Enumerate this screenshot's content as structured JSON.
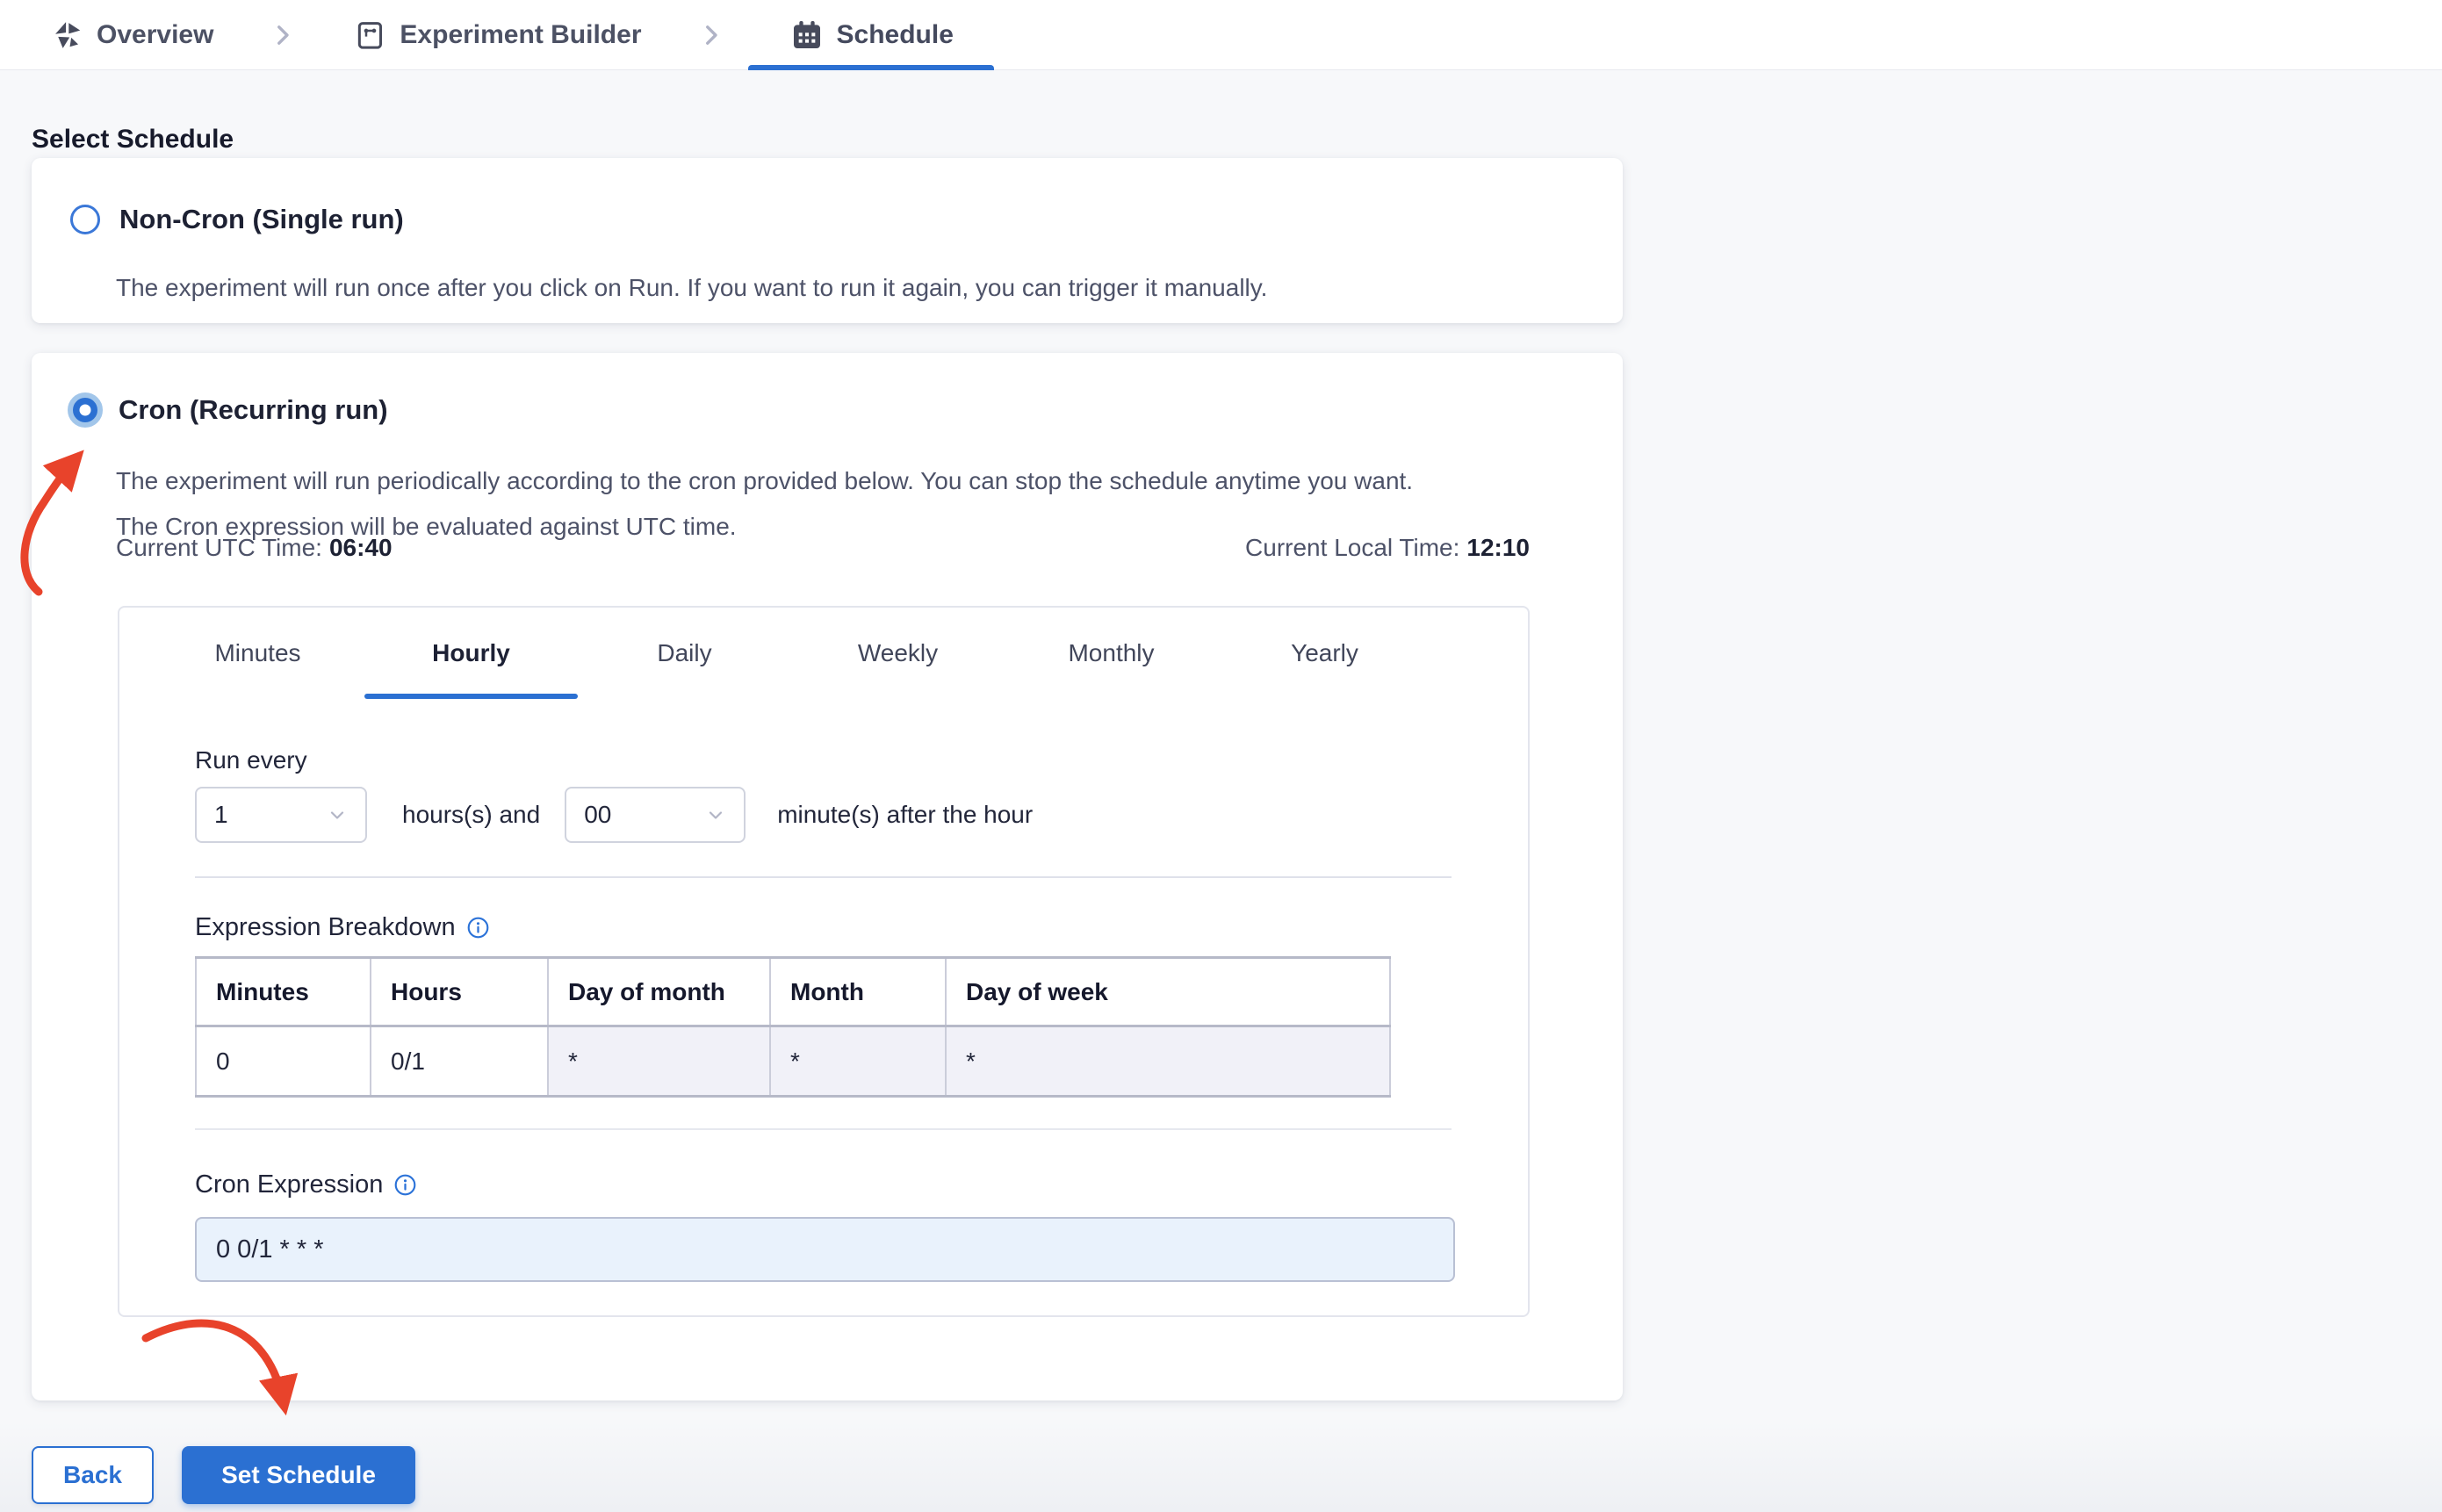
{
  "breadcrumb": {
    "items": [
      {
        "label": "Overview",
        "icon": "chaos-logo-icon"
      },
      {
        "label": "Experiment Builder",
        "icon": "experiment-builder-icon"
      },
      {
        "label": "Schedule",
        "icon": "calendar-icon",
        "active": true
      }
    ]
  },
  "page": {
    "title": "Select Schedule"
  },
  "options": {
    "non_cron": {
      "selected": false,
      "title": "Non-Cron (Single run)",
      "description": "The experiment will run once after you click on Run. If you want to run it again, you can trigger it manually."
    },
    "cron": {
      "selected": true,
      "title": "Cron (Recurring run)",
      "description_line1": "The experiment will run periodically according to the cron provided below. You can stop the schedule anytime you want.",
      "description_line2": "The Cron expression will be evaluated against UTC time.",
      "utc_label": "Current UTC Time:",
      "utc_value": "06:40",
      "local_label": "Current Local Time:",
      "local_value": "12:10"
    }
  },
  "scheduler": {
    "tabs": [
      "Minutes",
      "Hourly",
      "Daily",
      "Weekly",
      "Monthly",
      "Yearly"
    ],
    "active_tab": "Hourly",
    "run_every_label": "Run every",
    "hours_value": "1",
    "hours_suffix": "hours(s) and",
    "minutes_value": "00",
    "minutes_suffix": "minute(s) after the hour",
    "breakdown": {
      "label": "Expression Breakdown",
      "columns": [
        "Minutes",
        "Hours",
        "Day of month",
        "Month",
        "Day of week"
      ],
      "values": [
        "0",
        "0/1",
        "*",
        "*",
        "*"
      ]
    },
    "cron_expression": {
      "label": "Cron Expression",
      "value": "0 0/1 * * *"
    }
  },
  "footer": {
    "back_label": "Back",
    "set_schedule_label": "Set Schedule"
  },
  "colors": {
    "accent_blue": "#2b70d2",
    "annotation_red": "#e8432b",
    "shaded_cell": "#f1f1f8",
    "cron_input_bg": "#e9f2fc",
    "page_bg": "#f7f8fa"
  }
}
